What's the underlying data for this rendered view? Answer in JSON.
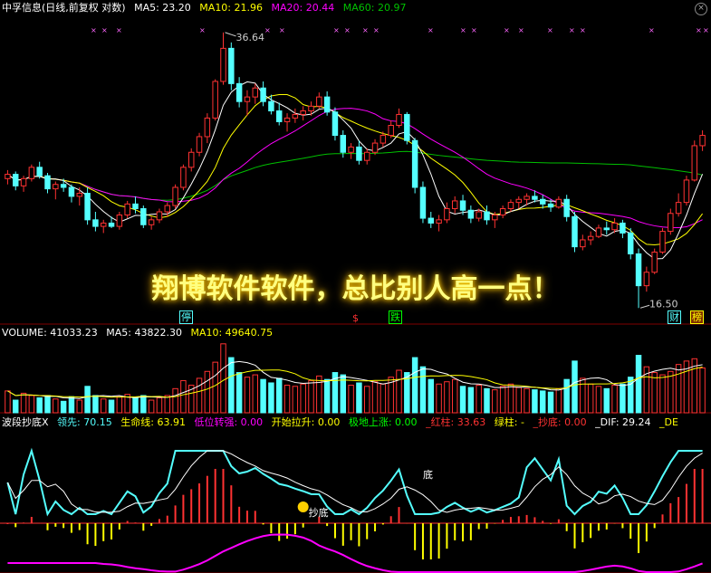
{
  "colors": {
    "up": "#ff3232",
    "down": "#54ffff",
    "ma5": "#ffffff",
    "ma10": "#ffff00",
    "ma20": "#ff00ff",
    "ma60": "#00c000",
    "bg": "#000000",
    "grid": "#800000"
  },
  "price_header": {
    "title": "中孚信息(日线,前复权 对数)",
    "ma5": "MA5: 23.20",
    "ma10": "MA10: 21.96",
    "ma20": "MA20: 20.44",
    "ma60": "MA60: 20.97"
  },
  "volume_header": {
    "vol": "VOLUME: 41033.23",
    "ma5": "MA5: 43822.30",
    "ma10": "MA10: 49640.75"
  },
  "indicator_header": {
    "name": "波段抄底X",
    "lingxian": "领先: 70.15",
    "shengming": "生命线: 63.91",
    "diwei": "低位转强: 0.00",
    "kaishi": "开始拉升: 0.00",
    "jidi": "极地上涨: 0.00",
    "hongzhu": "_红柱: 33.63",
    "lvzhu": "绿柱: -",
    "chaodi": "_抄底: 0.00",
    "dif": "_DIF: 29.24",
    "de": "_DE"
  },
  "watermark": "翔博软件软件，总比别人高一点！",
  "markers": {
    "high_label": "36.64",
    "low_label": "16.50",
    "ting": "停",
    "dollar": "$",
    "die": "跌",
    "cai": "财",
    "bang": "榜",
    "di": "底",
    "chaodi": "抄底"
  },
  "chart_data": {
    "type": "candlestick",
    "scale": "log",
    "ylim": [
      16.0,
      38.0
    ],
    "high": 36.64,
    "low": 16.5,
    "ohlc": [
      [
        24.0,
        24.6,
        23.6,
        24.3
      ],
      [
        24.3,
        24.5,
        23.2,
        23.5
      ],
      [
        23.5,
        24.2,
        23.1,
        24.0
      ],
      [
        24.0,
        25.0,
        23.8,
        24.8
      ],
      [
        24.8,
        25.2,
        24.0,
        24.2
      ],
      [
        24.2,
        24.4,
        23.0,
        23.3
      ],
      [
        23.3,
        23.8,
        22.6,
        23.6
      ],
      [
        23.6,
        24.0,
        23.1,
        23.4
      ],
      [
        23.4,
        23.6,
        22.4,
        22.8
      ],
      [
        22.8,
        23.4,
        22.2,
        23.0
      ],
      [
        23.0,
        23.4,
        21.0,
        21.3
      ],
      [
        21.3,
        21.8,
        20.6,
        20.9
      ],
      [
        20.9,
        21.3,
        20.5,
        21.1
      ],
      [
        21.1,
        21.5,
        20.8,
        20.9
      ],
      [
        20.9,
        21.8,
        20.7,
        21.6
      ],
      [
        21.6,
        22.5,
        21.4,
        22.3
      ],
      [
        22.3,
        22.8,
        21.7,
        22.0
      ],
      [
        22.0,
        22.2,
        20.8,
        21.0
      ],
      [
        21.0,
        21.5,
        20.7,
        21.3
      ],
      [
        21.3,
        22.0,
        21.1,
        21.8
      ],
      [
        21.8,
        22.4,
        21.5,
        22.2
      ],
      [
        22.2,
        23.6,
        22.0,
        23.4
      ],
      [
        23.4,
        25.0,
        23.2,
        24.8
      ],
      [
        24.8,
        26.2,
        24.5,
        25.9
      ],
      [
        25.9,
        27.4,
        25.6,
        27.1
      ],
      [
        27.1,
        29.0,
        26.6,
        28.6
      ],
      [
        28.6,
        32.0,
        28.4,
        31.8
      ],
      [
        31.8,
        36.64,
        31.5,
        35.0
      ],
      [
        35.0,
        35.6,
        31.0,
        31.6
      ],
      [
        31.6,
        32.2,
        29.5,
        30.0
      ],
      [
        30.0,
        31.0,
        28.8,
        30.4
      ],
      [
        30.4,
        31.6,
        29.8,
        31.2
      ],
      [
        31.2,
        31.8,
        29.6,
        30.0
      ],
      [
        30.0,
        30.6,
        28.9,
        29.2
      ],
      [
        29.2,
        29.9,
        28.0,
        28.3
      ],
      [
        28.3,
        29.0,
        27.5,
        28.6
      ],
      [
        28.6,
        29.4,
        28.2,
        28.9
      ],
      [
        28.9,
        29.6,
        28.4,
        29.2
      ],
      [
        29.2,
        30.0,
        28.8,
        29.6
      ],
      [
        29.6,
        30.8,
        29.4,
        30.4
      ],
      [
        30.4,
        30.9,
        28.8,
        29.1
      ],
      [
        29.1,
        29.5,
        26.8,
        27.2
      ],
      [
        27.2,
        27.6,
        25.5,
        25.9
      ],
      [
        25.9,
        26.6,
        25.4,
        26.3
      ],
      [
        26.3,
        26.8,
        25.0,
        25.3
      ],
      [
        25.3,
        26.2,
        25.0,
        25.9
      ],
      [
        25.9,
        26.9,
        25.7,
        26.6
      ],
      [
        26.6,
        27.5,
        26.3,
        27.2
      ],
      [
        27.2,
        28.4,
        27.0,
        28.0
      ],
      [
        28.0,
        29.4,
        27.8,
        28.9
      ],
      [
        28.9,
        29.1,
        26.5,
        26.8
      ],
      [
        26.8,
        27.0,
        23.0,
        23.4
      ],
      [
        23.4,
        23.8,
        21.1,
        21.4
      ],
      [
        21.4,
        21.8,
        20.8,
        21.1
      ],
      [
        21.1,
        21.6,
        20.6,
        21.3
      ],
      [
        21.3,
        22.4,
        21.1,
        22.0
      ],
      [
        22.0,
        22.8,
        21.7,
        22.5
      ],
      [
        22.5,
        22.9,
        21.6,
        21.9
      ],
      [
        21.9,
        22.2,
        21.1,
        21.4
      ],
      [
        21.4,
        22.0,
        21.2,
        21.8
      ],
      [
        21.8,
        22.2,
        21.0,
        21.3
      ],
      [
        21.3,
        21.8,
        20.8,
        21.6
      ],
      [
        21.6,
        22.2,
        21.4,
        22.0
      ],
      [
        22.0,
        22.6,
        21.8,
        22.4
      ],
      [
        22.4,
        22.8,
        22.0,
        22.6
      ],
      [
        22.6,
        23.0,
        22.2,
        22.8
      ],
      [
        22.8,
        23.2,
        22.4,
        22.6
      ],
      [
        22.6,
        22.9,
        22.0,
        22.3
      ],
      [
        22.3,
        22.6,
        21.8,
        22.1
      ],
      [
        22.1,
        22.8,
        22.0,
        22.6
      ],
      [
        22.6,
        22.9,
        21.2,
        21.5
      ],
      [
        21.5,
        21.8,
        19.4,
        19.7
      ],
      [
        19.7,
        20.4,
        19.5,
        20.1
      ],
      [
        20.1,
        20.6,
        19.8,
        20.3
      ],
      [
        20.3,
        21.0,
        20.2,
        20.8
      ],
      [
        20.8,
        21.2,
        20.4,
        20.7
      ],
      [
        20.7,
        21.4,
        20.5,
        21.1
      ],
      [
        21.1,
        21.3,
        20.2,
        20.5
      ],
      [
        20.5,
        20.8,
        19.0,
        19.3
      ],
      [
        19.3,
        19.6,
        16.5,
        17.6
      ],
      [
        17.6,
        18.6,
        17.3,
        18.3
      ],
      [
        18.3,
        19.6,
        18.2,
        19.4
      ],
      [
        19.4,
        20.8,
        19.3,
        20.6
      ],
      [
        20.6,
        22.0,
        20.4,
        21.7
      ],
      [
        21.7,
        23.0,
        21.5,
        22.4
      ],
      [
        22.4,
        24.2,
        22.2,
        23.9
      ],
      [
        23.9,
        26.8,
        23.8,
        26.4
      ],
      [
        26.4,
        27.6,
        26.0,
        27.2
      ]
    ],
    "ma_series": [
      {
        "name": "MA5",
        "value": 23.2,
        "color": "#ffffff"
      },
      {
        "name": "MA10",
        "value": 21.96,
        "color": "#ffff00"
      },
      {
        "name": "MA20",
        "value": 20.44,
        "color": "#ff00ff"
      },
      {
        "name": "MA60",
        "value": 20.97,
        "color": "#00c000"
      }
    ],
    "volume": [
      38,
      22,
      34,
      30,
      26,
      30,
      24,
      20,
      28,
      22,
      46,
      30,
      24,
      22,
      28,
      32,
      26,
      30,
      22,
      26,
      30,
      42,
      56,
      48,
      60,
      72,
      88,
      120,
      96,
      70,
      62,
      66,
      58,
      52,
      60,
      48,
      46,
      50,
      56,
      64,
      58,
      70,
      66,
      48,
      52,
      46,
      54,
      50,
      62,
      74,
      70,
      96,
      80,
      58,
      50,
      54,
      58,
      46,
      44,
      48,
      42,
      40,
      46,
      50,
      44,
      42,
      40,
      38,
      36,
      42,
      58,
      90,
      60,
      50,
      46,
      42,
      48,
      50,
      62,
      100,
      80,
      70,
      66,
      72,
      84,
      90,
      94,
      78
    ],
    "volume_ma5": 43822.3,
    "volume_ma10": 49640.75,
    "volume_last": 41033.23
  }
}
